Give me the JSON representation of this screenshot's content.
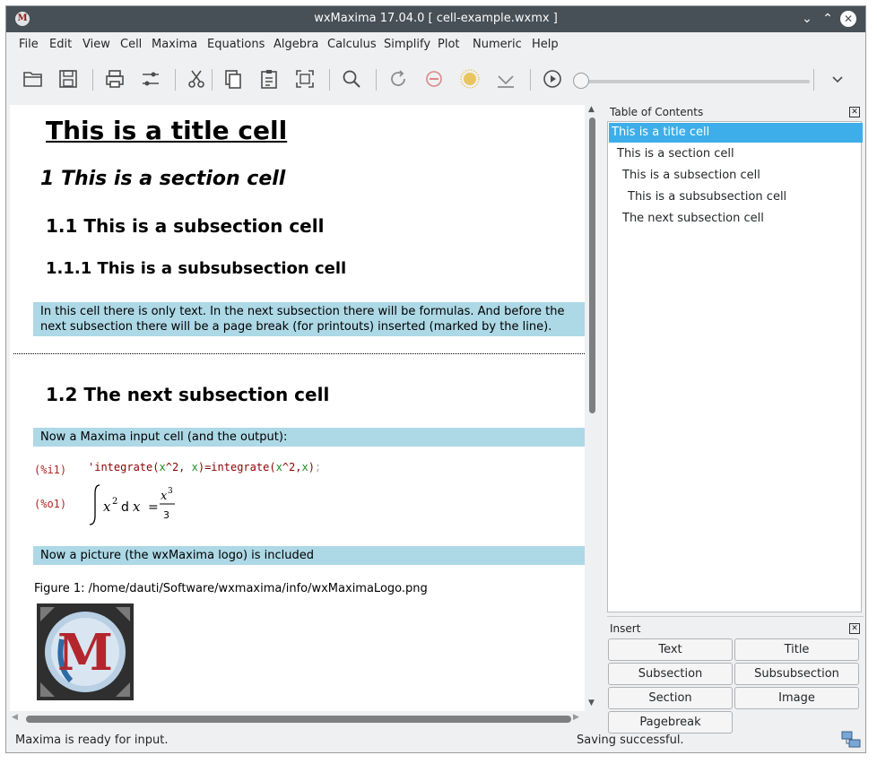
{
  "window": {
    "title": "wxMaxima 17.04.0  [ cell-example.wxmx ]",
    "icon": "M",
    "controls": [
      "chevron-down",
      "chevron-up",
      "close"
    ]
  },
  "menu": [
    "File",
    "Edit",
    "View",
    "Cell",
    "Maxima",
    "Equations",
    "Algebra",
    "Calculus",
    "Simplify",
    "Plot",
    "Numeric",
    "Help"
  ],
  "toolbar": {
    "icons": [
      "open-folder-icon",
      "save-icon",
      "print-icon",
      "settings-sliders-icon",
      "cut-icon",
      "copy-icon",
      "paste-icon",
      "select-all-icon",
      "find-icon",
      "restart-icon",
      "interrupt-icon",
      "follow-icon",
      "evaluate-all-icon",
      "play-icon",
      "overflow-chevron-icon"
    ]
  },
  "worksheet": {
    "title": "This is a title cell",
    "section": "1  This is a section cell",
    "subsection1": "1.1  This is a subsection cell",
    "subsubsection": "1.1.1  This is a subsubsection cell",
    "text1_line1": "In this cell there is only text.  In the next subsection there will be formulas. And before the",
    "text1_line2": "next subsection there will be a page break (for printouts) inserted (marked by the line).",
    "subsection2": "1.2  The next subsection cell",
    "text2": "Now a Maxima input cell (and the output):",
    "input_label": "(%i1)",
    "input_code": "'integrate(x^2, x)=integrate(x^2,x);",
    "output_label": "(%o1)",
    "text3": "Now a picture (the wxMaxima logo) is included",
    "figure_caption": "Figure 1: /home/dauti/Software/wxmaxima/info/wxMaximaLogo.png",
    "logo_letter": "M"
  },
  "toc": {
    "title": "Table of Contents",
    "items": [
      {
        "label": "This is a title cell",
        "selected": true
      },
      {
        "label": "This is a section cell",
        "selected": false
      },
      {
        "label": "This is a subsection cell",
        "selected": false
      },
      {
        "label": "This is a subsubsection cell",
        "selected": false
      },
      {
        "label": "The next subsection cell",
        "selected": false
      }
    ]
  },
  "insert": {
    "title": "Insert",
    "buttons": [
      "Text",
      "Title",
      "Subsection",
      "Subsubsection",
      "Section",
      "Image",
      "Pagebreak"
    ]
  },
  "status": {
    "left": "Maxima is ready for input.",
    "right": "Saving successful."
  },
  "colors": {
    "titlebar": "#475057",
    "text_cell_bg": "#add8e6",
    "toc_selected": "#3daee9",
    "label_red": "#b22222"
  }
}
